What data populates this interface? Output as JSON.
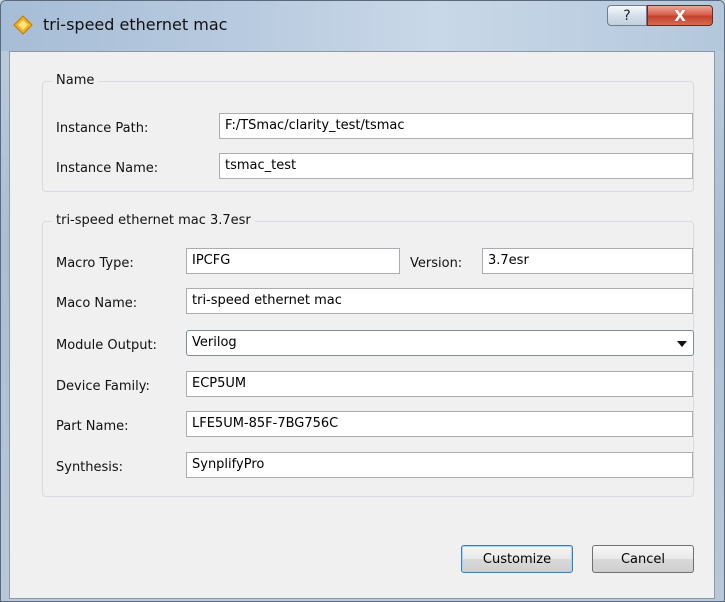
{
  "window": {
    "title": "tri-speed ethernet mac",
    "help_label": "?",
    "close_label": "X"
  },
  "name_group": {
    "title": "Name",
    "instance_path_label": "Instance Path:",
    "instance_path_value": "F:/TSmac/clarity_test/tsmac",
    "instance_name_label": "Instance Name:",
    "instance_name_value": "tsmac_test"
  },
  "ip_group": {
    "title": "tri-speed ethernet mac 3.7esr",
    "macro_type_label": "Macro Type:",
    "macro_type_value": "IPCFG",
    "version_label": "Version:",
    "version_value": "3.7esr",
    "maco_name_label": "Maco Name:",
    "maco_name_value": "tri-speed ethernet mac",
    "module_output_label": "Module Output:",
    "module_output_value": "Verilog",
    "device_family_label": "Device Family:",
    "device_family_value": "ECP5UM",
    "part_name_label": "Part Name:",
    "part_name_value": "LFE5UM-85F-7BG756C",
    "synthesis_label": "Synthesis:",
    "synthesis_value": "SynplifyPro"
  },
  "buttons": {
    "customize": "Customize",
    "cancel": "Cancel"
  }
}
